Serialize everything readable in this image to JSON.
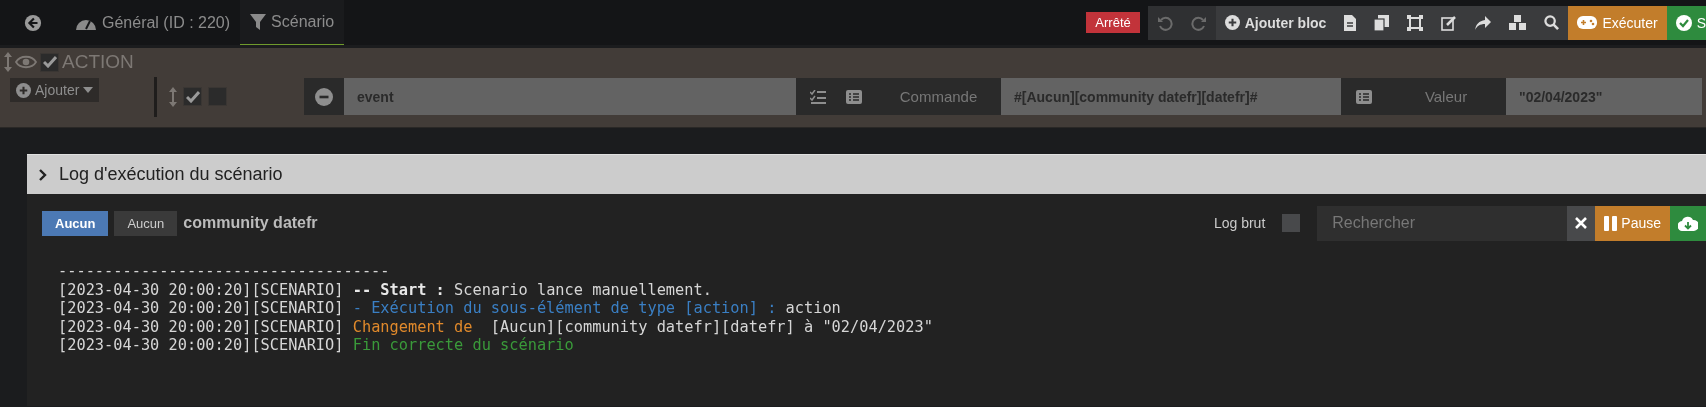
{
  "tabs": [
    {
      "label": "Général (ID : 220)",
      "selected": false
    },
    {
      "label": "Scénario",
      "selected": true
    }
  ],
  "status_badge": "Arrêté",
  "toolbar": {
    "undo_disabled": true,
    "redo_disabled": true,
    "add_block": "Ajouter bloc",
    "execute": "Exécuter",
    "save": "S"
  },
  "action_block": {
    "title": "ACTION",
    "enabled": true,
    "add_button": "Ajouter",
    "row": {
      "enabled": true,
      "option": false,
      "expression": "event",
      "command_label": "Commande",
      "command": "#[Aucun][community datefr][datefr]#",
      "value_label": "Valeur",
      "value": "\"02/04/2023\""
    }
  },
  "log_panel": {
    "title": "Log d'exécution du scénario",
    "filters": [
      {
        "label": "Aucun",
        "selected": true
      },
      {
        "label": "Aucun",
        "selected": false
      }
    ],
    "object_name": "community datefr",
    "raw_log_label": "Log brut",
    "raw_log_checked": false,
    "search_placeholder": "Rechercher",
    "pause": "Pause",
    "lines": [
      [
        {
          "kind": "plain",
          "text": "------------------------------------"
        }
      ],
      [
        {
          "kind": "plain",
          "text": "[2023-04-30 20:00:20][SCENARIO] "
        },
        {
          "kind": "bold",
          "text": "-- Start :"
        },
        {
          "kind": "plain",
          "text": " Scenario lance manuellement."
        }
      ],
      [
        {
          "kind": "plain",
          "text": "[2023-04-30 20:00:20][SCENARIO] "
        },
        {
          "kind": "info",
          "text": "- Exécution du sous-élément de type [action] :"
        },
        {
          "kind": "plain",
          "text": " action"
        }
      ],
      [
        {
          "kind": "plain",
          "text": "[2023-04-30 20:00:20][SCENARIO] "
        },
        {
          "kind": "warn",
          "text": "Changement de "
        },
        {
          "kind": "plain",
          "text": " [Aucun][community datefr][datefr] à \"02/04/2023\""
        }
      ],
      [
        {
          "kind": "plain",
          "text": "[2023-04-30 20:00:20][SCENARIO] "
        },
        {
          "kind": "ok",
          "text": "Fin correcte du scénario"
        }
      ]
    ]
  }
}
